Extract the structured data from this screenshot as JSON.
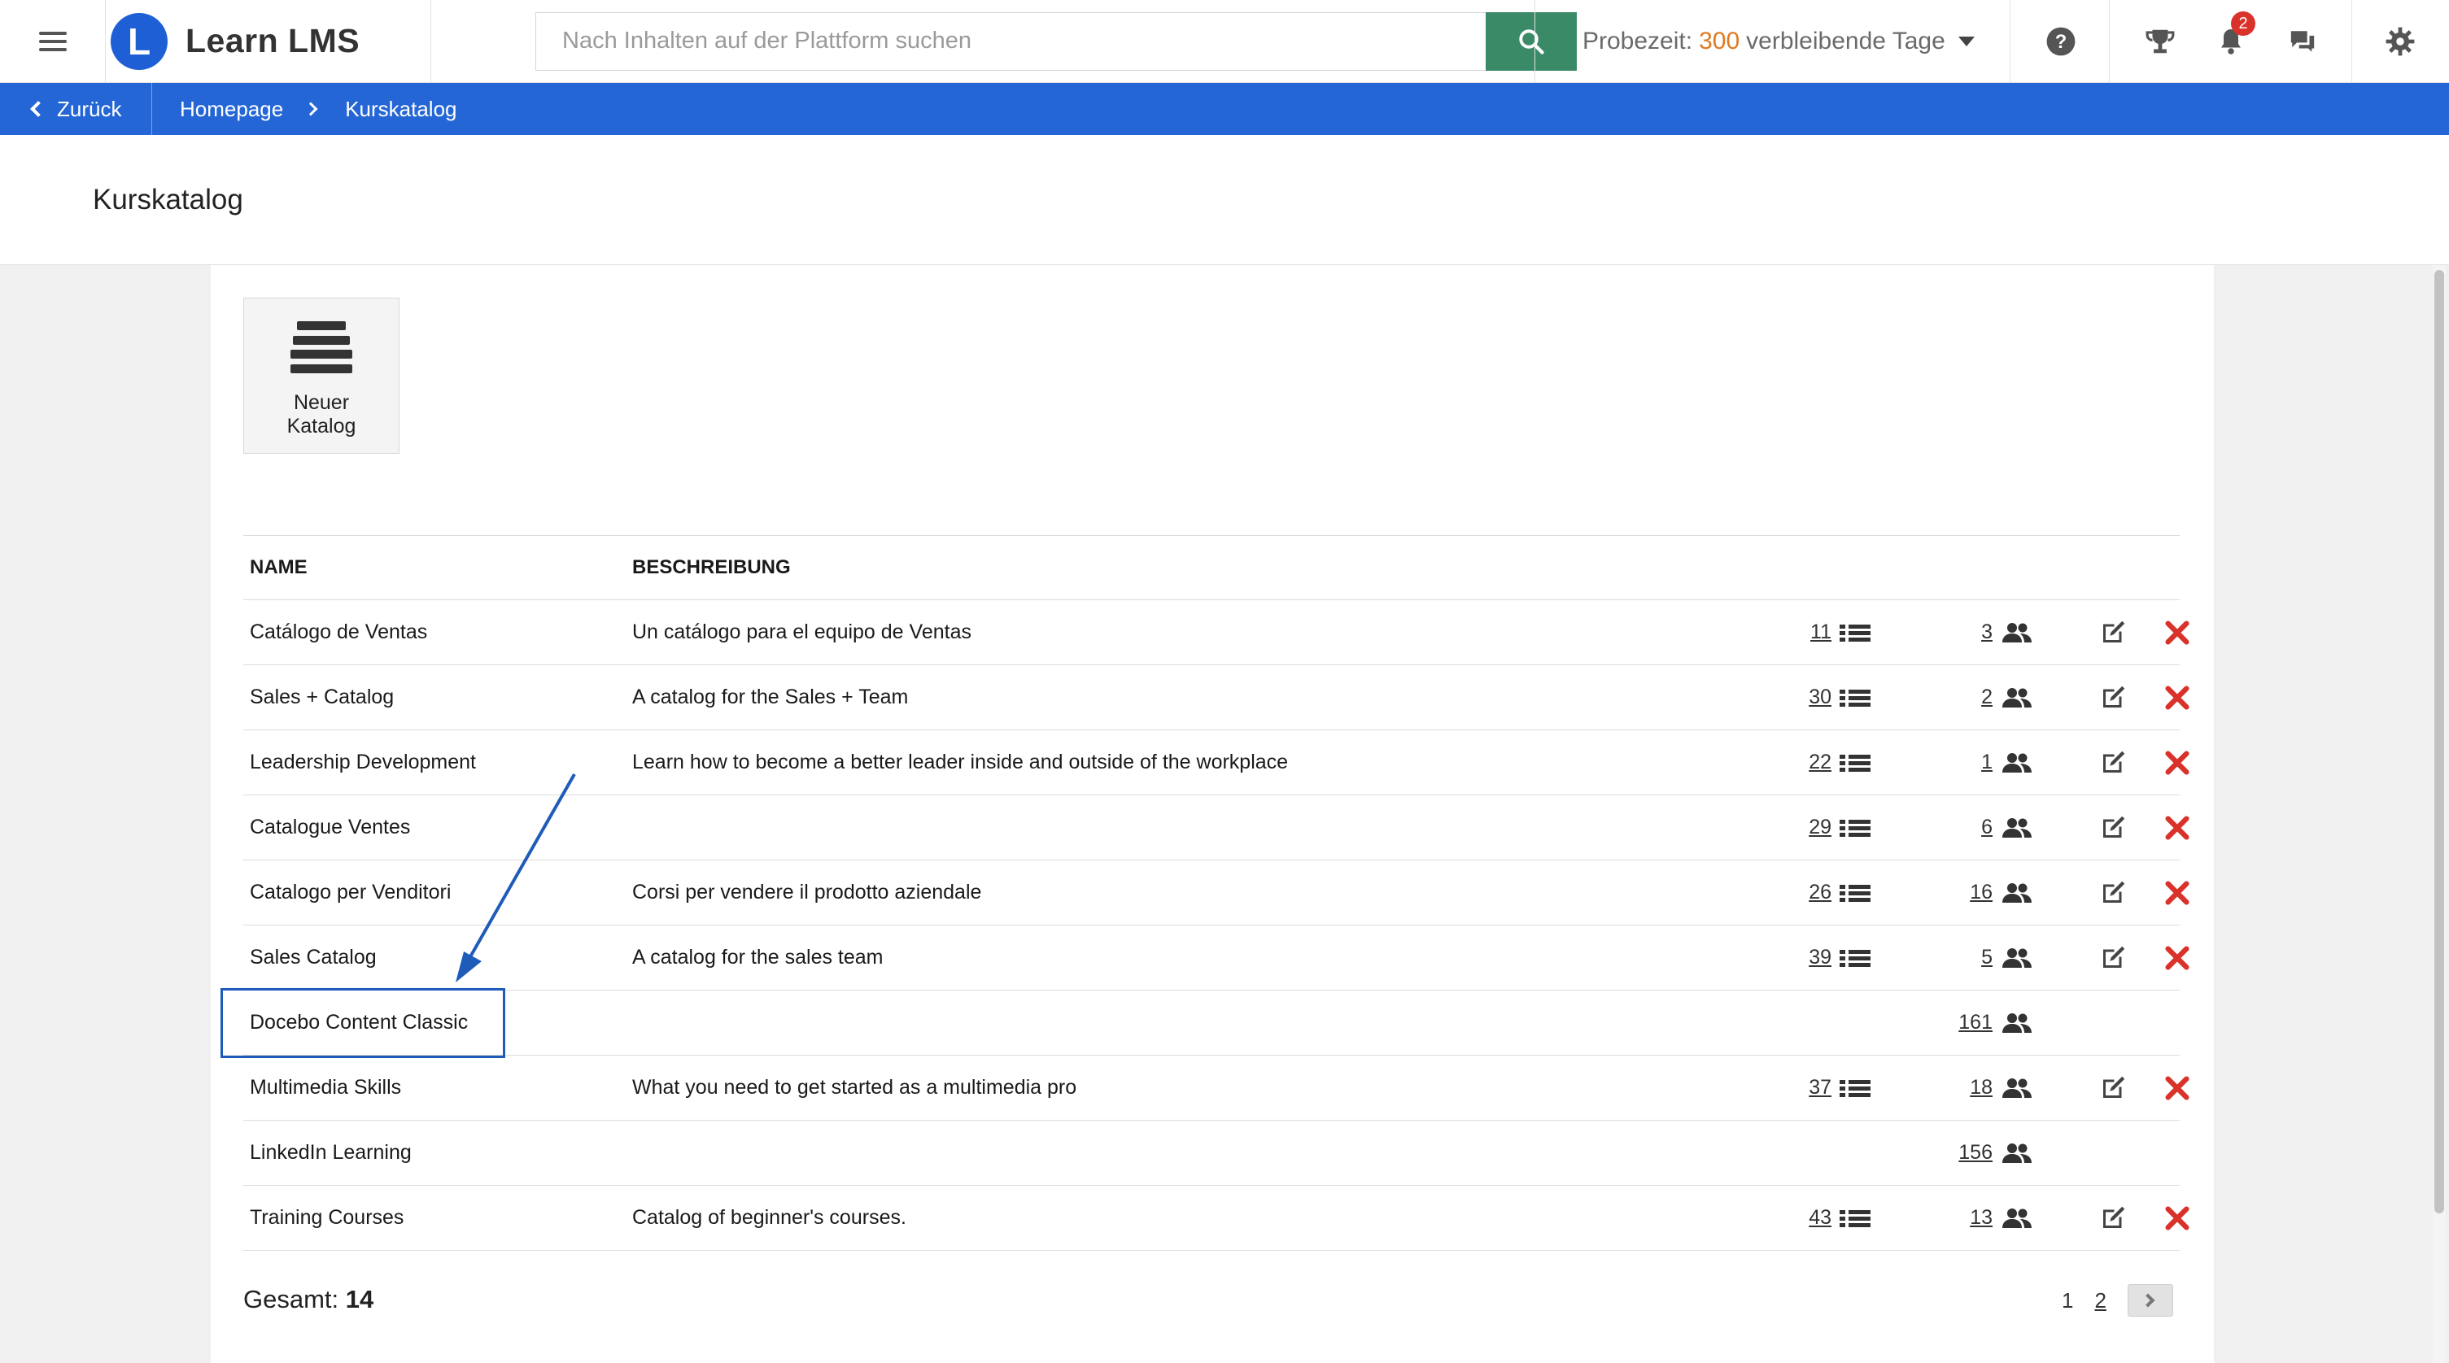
{
  "header": {
    "app_name": "Learn LMS",
    "logo_letter": "L",
    "search_placeholder": "Nach Inhalten auf der Plattform suchen",
    "trial_prefix": "Probezeit:",
    "trial_days": "300",
    "trial_suffix": "verbleibende Tage",
    "notifications_count": "2",
    "accent_color": "#e07a1f",
    "brand_color": "#1f5fd6",
    "icons": [
      "menu-icon",
      "search-icon",
      "help-icon",
      "trophy-icon",
      "bell-icon",
      "chat-icon",
      "gear-icon"
    ]
  },
  "breadcrumb": {
    "back_label": "Zurück",
    "items": [
      "Homepage",
      "Kurskatalog"
    ]
  },
  "page": {
    "title": "Kurskatalog",
    "new_catalog_line1": "Neuer",
    "new_catalog_line2": "Katalog"
  },
  "table": {
    "columns": {
      "name": "NAME",
      "description": "BESCHREIBUNG"
    },
    "rows": [
      {
        "name": "Catálogo de Ventas",
        "description": "Un catálogo para el equipo de Ventas",
        "courses": "11",
        "users": "3",
        "editable": true
      },
      {
        "name": "Sales + Catalog",
        "description": "A catalog for the Sales + Team",
        "courses": "30",
        "users": "2",
        "editable": true
      },
      {
        "name": "Leadership Development",
        "description": "Learn how to become a better leader inside and outside of the workplace",
        "courses": "22",
        "users": "1",
        "editable": true
      },
      {
        "name": "Catalogue Ventes",
        "description": "",
        "courses": "29",
        "users": "6",
        "editable": true
      },
      {
        "name": "Catalogo per Venditori",
        "description": "Corsi per vendere il prodotto aziendale",
        "courses": "26",
        "users": "16",
        "editable": true
      },
      {
        "name": "Sales Catalog",
        "description": "A catalog for the sales team",
        "courses": "39",
        "users": "5",
        "editable": true
      },
      {
        "name": "Docebo Content Classic",
        "description": "",
        "courses": "",
        "users": "161",
        "editable": false
      },
      {
        "name": "Multimedia Skills",
        "description": "What you need to get started as a multimedia pro",
        "courses": "37",
        "users": "18",
        "editable": true
      },
      {
        "name": "LinkedIn Learning",
        "description": "",
        "courses": "",
        "users": "156",
        "editable": false
      },
      {
        "name": "Training Courses",
        "description": "Catalog of beginner's courses.",
        "courses": "43",
        "users": "13",
        "editable": true
      }
    ]
  },
  "footer": {
    "total_label": "Gesamt:",
    "total_value": "14",
    "pages": [
      "1",
      "2"
    ]
  }
}
